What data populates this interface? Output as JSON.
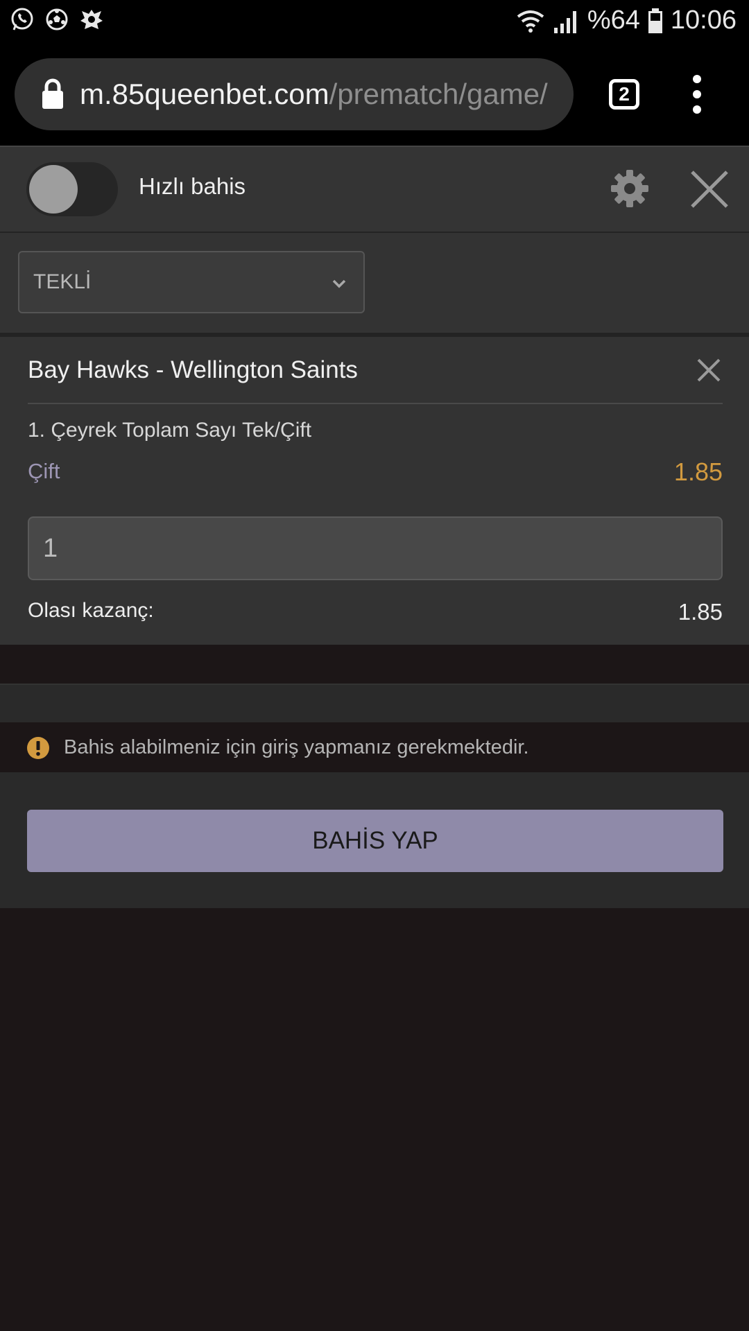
{
  "status_bar": {
    "battery": "%64",
    "time": "10:06",
    "left_icons": [
      "whatsapp-icon",
      "soccer-ball-icon",
      "app-icon"
    ]
  },
  "browser": {
    "url_host": "m.85queenbet.com",
    "url_path": "/prematch/game/",
    "tab_count": "2"
  },
  "betslip": {
    "quick_bet_label": "Hızlı bahis",
    "quick_bet_enabled": false,
    "bet_type": "TEKLİ",
    "match": "Bay Hawks - Wellington Saints",
    "market": "1. Çeyrek Toplam Sayı Tek/Çift",
    "pick": "Çift",
    "odds": "1.85",
    "stake": "1",
    "potential_win_label": "Olası kazanç:",
    "potential_win": "1.85",
    "login_warning": "Bahis alabilmeniz için giriş yapmanız gerekmektedir.",
    "place_bet_label": "BAHİS YAP"
  },
  "colors": {
    "odds": "#d29a3f",
    "pick": "#9d96b4",
    "button": "#8f8aa9",
    "warning": "#d29a3f"
  }
}
